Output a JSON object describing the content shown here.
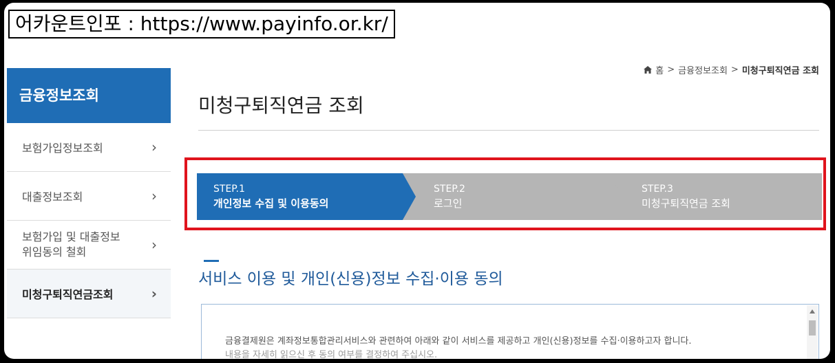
{
  "caption": "어카운트인포 : https://www.payinfo.or.kr/",
  "sidebar": {
    "title": "금융정보조회",
    "items": [
      {
        "label": "보험가입정보조회"
      },
      {
        "label": "대출정보조회"
      },
      {
        "label_line1": "보험가입 및 대출정보",
        "label_line2": "위임동의 철회"
      },
      {
        "label": "미청구퇴직연금조회"
      }
    ],
    "chevron": "›"
  },
  "breadcrumb": {
    "home": "홈",
    "sep": ">",
    "level1": "금융정보조회",
    "current": "미청구퇴직연금 조회"
  },
  "page_title": "미청구퇴직연금 조회",
  "steps": [
    {
      "num": "STEP.1",
      "label": "개인정보 수집 및 이용동의",
      "state": "active"
    },
    {
      "num": "STEP.2",
      "label": "로그인",
      "state": "inactive"
    },
    {
      "num": "STEP.3",
      "label": "미청구퇴직연금 조회",
      "state": "inactive"
    }
  ],
  "section_title": "서비스 이용 및 개인(신용)정보 수집·이용 동의",
  "consent": {
    "line1": "금융결제원은 계좌정보통합관리서비스와 관련하여 아래와 같이 서비스를 제공하고 개인(신용)정보를 수집·이용하고자 합니다.",
    "line2": "내용을 자세히 읽으신 후 동의 여부를 결정하여 주십시오."
  },
  "colors": {
    "accent": "#1f6db5",
    "highlight_border": "#e0141d",
    "inactive_step": "#b5b5b5"
  }
}
